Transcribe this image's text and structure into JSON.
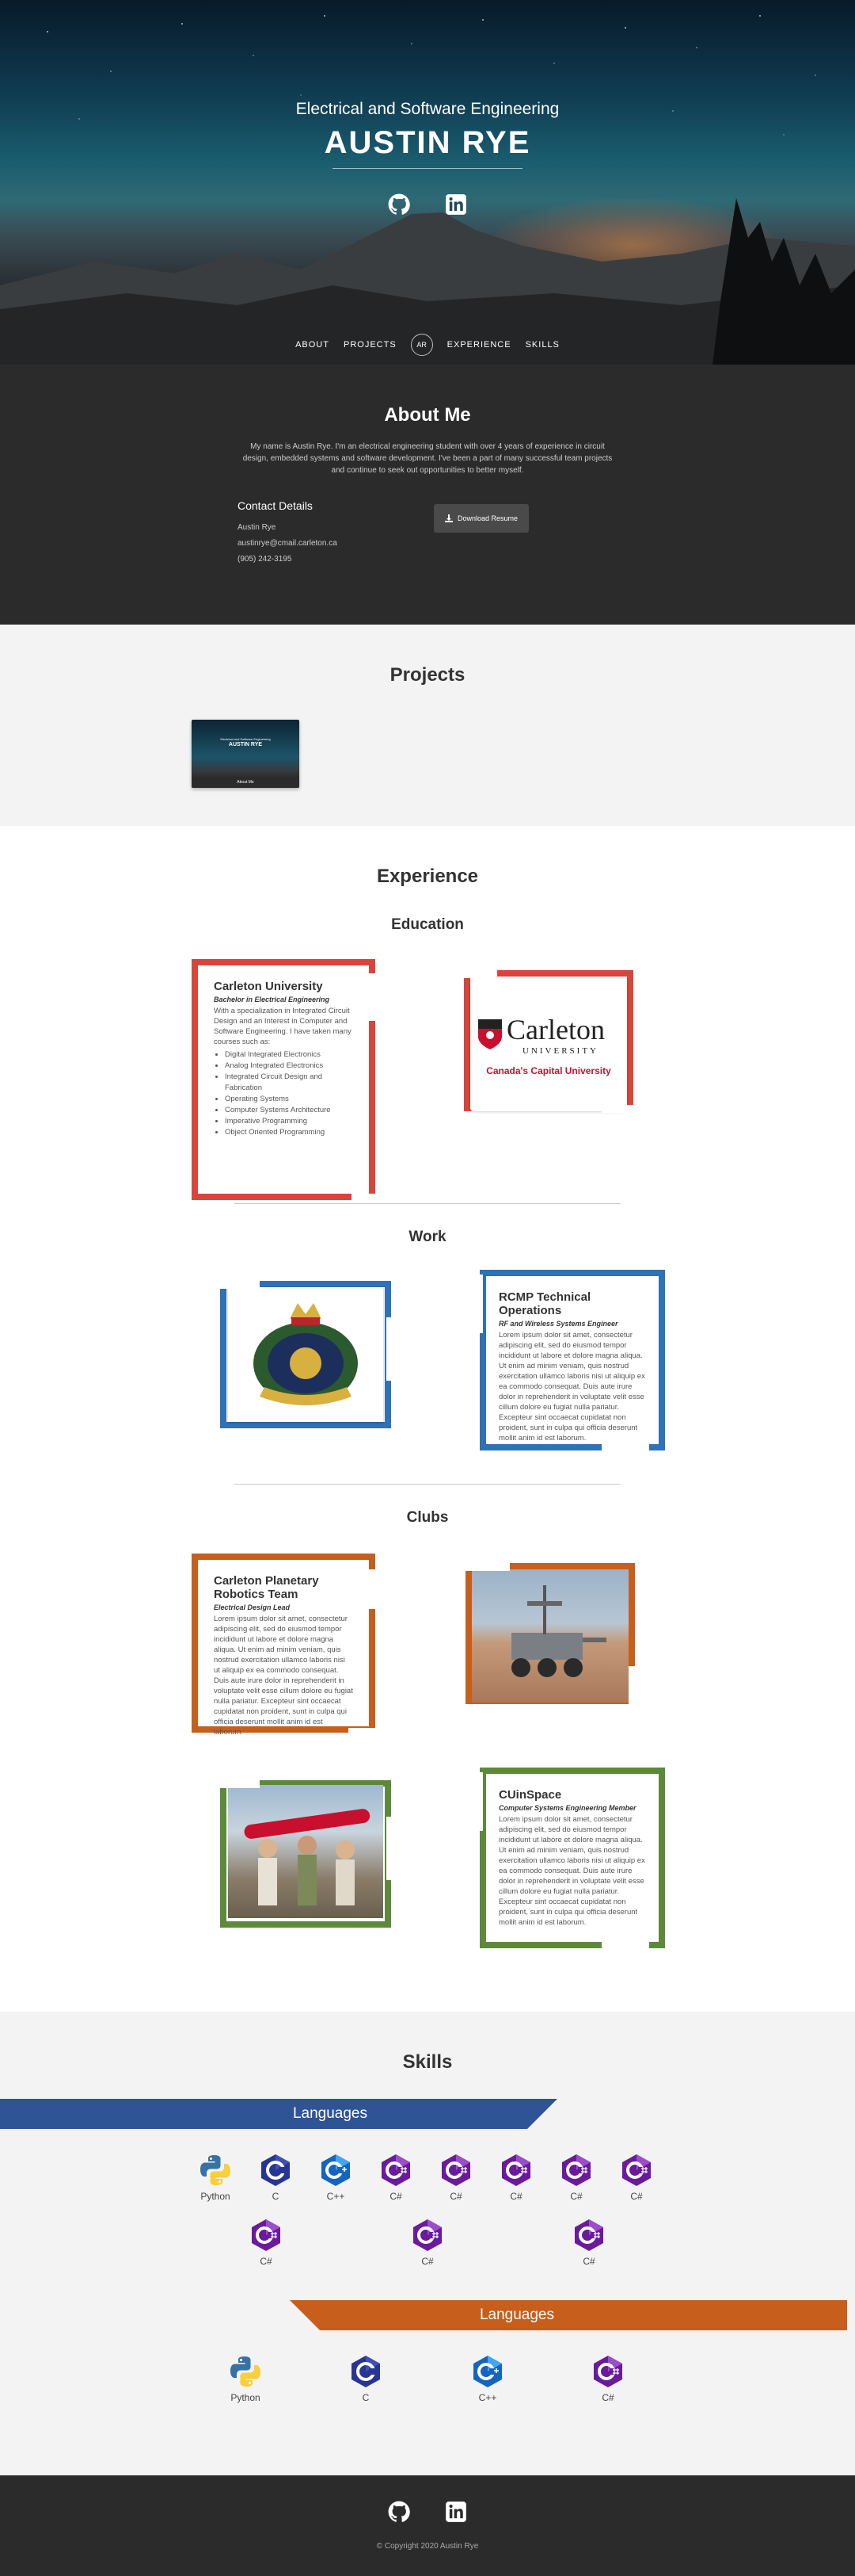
{
  "hero": {
    "subtitle": "Electrical and Software Engineering",
    "title": "AUSTIN RYE",
    "social": [
      "github-icon",
      "linkedin-icon"
    ]
  },
  "nav": {
    "items": [
      "ABOUT",
      "PROJECTS",
      "EXPERIENCE",
      "SKILLS"
    ],
    "logo": "AR"
  },
  "about": {
    "heading": "About Me",
    "bio": "My name is Austin Rye. I'm an electrical engineering student with over 4 years of experience in circuit design, embedded systems and software development. I've been a part of many successful team projects and continue to seek out opportunities to better myself.",
    "contact_heading": "Contact Details",
    "contact": [
      "Austin Rye",
      "austinrye@cmail.carleton.ca",
      "(905) 242-3195"
    ],
    "download_label": "Download Resume"
  },
  "projects": {
    "heading": "Projects",
    "thumb_title": "AUSTIN RYE",
    "thumb_sub": "Electrical and Software Engineering",
    "thumb_bar": "About Me"
  },
  "experience": {
    "heading": "Experience",
    "education_heading": "Education",
    "education": {
      "title": "Carleton University",
      "subtitle": "Bachelor in Electrical Engineering",
      "desc": "With a specialization in Integrated Circuit Design and an Interest in Computer and Software Engineering. I have taken many courses such as:",
      "courses": [
        "Digital Integrated Electronics",
        "Analog Integrated Electronics",
        "Integrated Circuit Design and Fabrication",
        "Operating Systems",
        "Computer Systems Architecture",
        "Imperative Programming",
        "Object Oriented Programming"
      ],
      "logo_word": "Carleton",
      "logo_sub": "UNIVERSITY",
      "logo_tag": "Canada's Capital University"
    },
    "work_heading": "Work",
    "work": {
      "title": "RCMP Technical Operations",
      "subtitle": "RF and Wireless Systems Engineer",
      "desc": "Lorem ipsum dolor sit amet, consectetur adipiscing elit, sed do eiusmod tempor incididunt ut labore et dolore magna aliqua. Ut enim ad minim veniam, quis nostrud exercitation ullamco laboris nisi ut aliquip ex ea commodo consequat. Duis aute irure dolor in reprehenderit in voluptate velit esse cillum dolore eu fugiat nulla pariatur. Excepteur sint occaecat cupidatat non proident, sunt in culpa qui officia deserunt mollit anim id est laborum."
    },
    "clubs_heading": "Clubs",
    "clubs": [
      {
        "title": "Carleton Planetary Robotics Team",
        "subtitle": "Electrical Design Lead",
        "desc": "Lorem ipsum dolor sit amet, consectetur adipiscing elit, sed do eiusmod tempor incididunt ut labore et dolore magna aliqua. Ut enim ad minim veniam, quis nostrud exercitation ullamco laboris nisi ut aliquip ex ea commodo consequat. Duis aute irure dolor in reprehenderit in voluptate velit esse cillum dolore eu fugiat nulla pariatur. Excepteur sint occaecat cupidatat non proident, sunt in culpa qui officia deserunt mollit anim id est laborum."
      },
      {
        "title": "CUinSpace",
        "subtitle": "Computer Systems Engineering Member",
        "desc": "Lorem ipsum dolor sit amet, consectetur adipiscing elit, sed do eiusmod tempor incididunt ut labore et dolore magna aliqua. Ut enim ad minim veniam, quis nostrud exercitation ullamco laboris nisi ut aliquip ex ea commodo consequat. Duis aute irure dolor in reprehenderit in voluptate velit esse cillum dolore eu fugiat nulla pariatur. Excepteur sint occaecat cupidatat non proident, sunt in culpa qui officia deserunt mollit anim id est laborum."
      }
    ],
    "colors": {
      "education": "#d9453b",
      "work": "#2f72b8",
      "club1": "#c85e1c",
      "club2": "#5c8a3a"
    }
  },
  "skills": {
    "heading": "Skills",
    "banner1": "Languages",
    "banner2": "Languages",
    "row1": [
      "Python",
      "C",
      "C++",
      "C#",
      "C#",
      "C#",
      "C#",
      "C#"
    ],
    "row2": [
      "C#",
      "C#",
      "C#"
    ],
    "row3": [
      "Python",
      "C",
      "C++",
      "C#"
    ],
    "colors": {
      "banner1": "#2f5496",
      "banner2": "#c85e1c"
    }
  },
  "footer": {
    "copyright": "© Copyright 2020 Austin Rye"
  }
}
